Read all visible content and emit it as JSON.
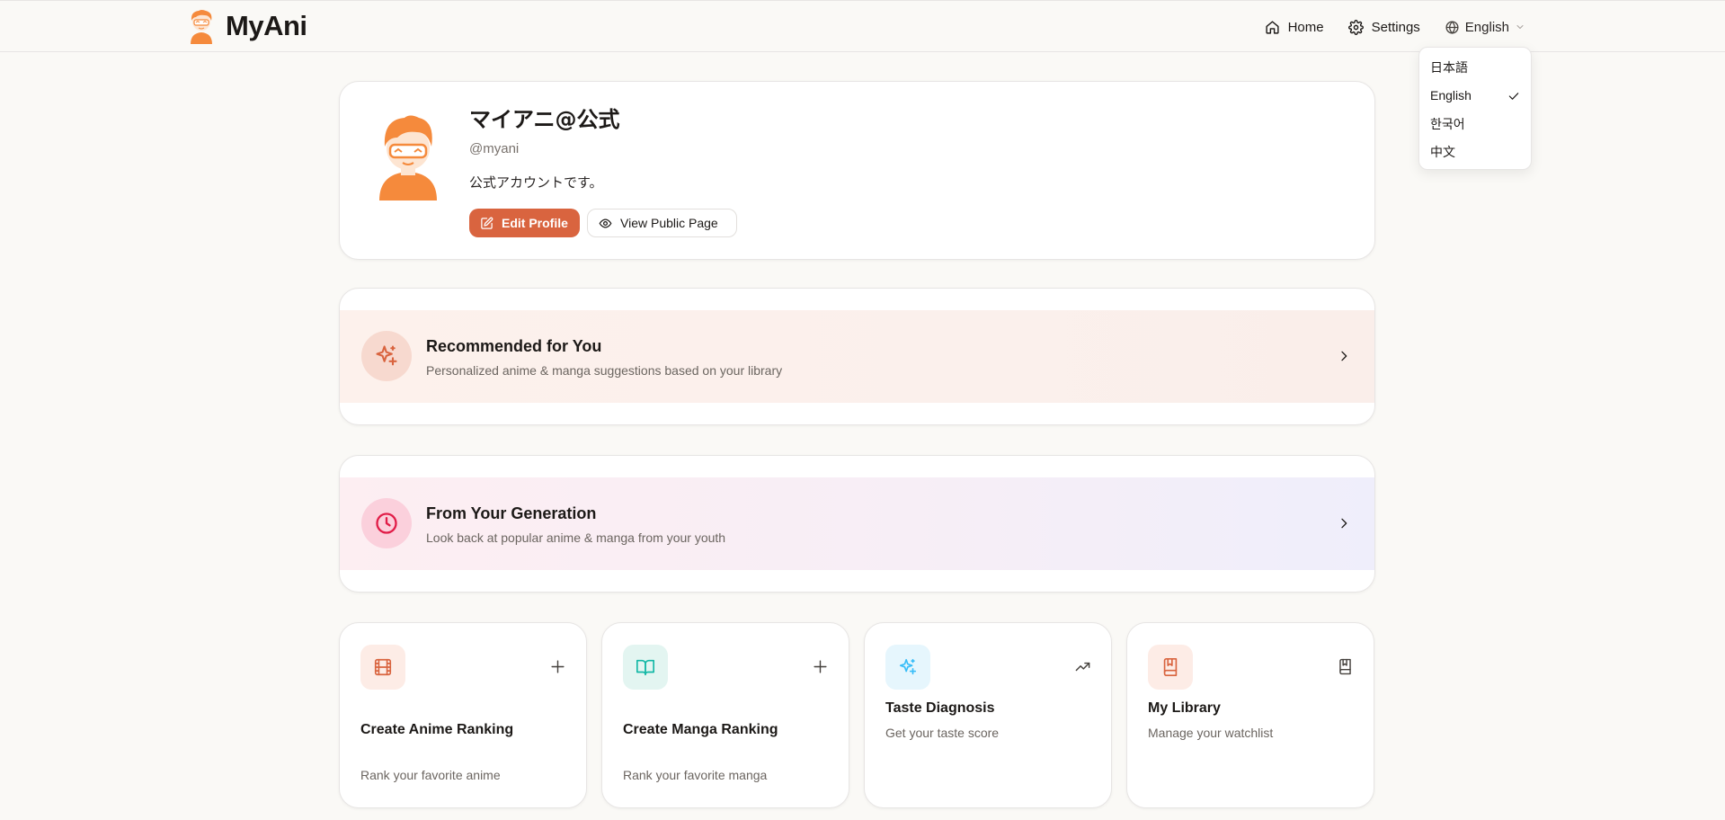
{
  "header": {
    "brand": "MyAni",
    "nav": {
      "home": "Home",
      "settings": "Settings",
      "language": "English"
    }
  },
  "language_menu": {
    "options": [
      "日本語",
      "English",
      "한국어",
      "中文"
    ],
    "selected": "English"
  },
  "profile": {
    "name": "マイアニ@公式",
    "handle": "@myani",
    "bio": "公式アカウントです。",
    "edit_button": "Edit Profile",
    "view_button": "View Public Page"
  },
  "features": {
    "recommended": {
      "title": "Recommended for You",
      "description": "Personalized anime & manga suggestions based on your library"
    },
    "generation": {
      "title": "From Your Generation",
      "description": "Look back at popular anime & manga from your youth"
    }
  },
  "tiles": [
    {
      "title": "Create Anime Ranking",
      "description": "Rank your favorite anime",
      "icon": "film-icon",
      "action_icon": "plus-icon"
    },
    {
      "title": "Create Manga Ranking",
      "description": "Rank your favorite manga",
      "icon": "book-open-icon",
      "action_icon": "plus-icon"
    },
    {
      "title": "Taste Diagnosis",
      "description": "Get your taste score",
      "icon": "sparkles-icon",
      "action_icon": "trending-up-icon"
    },
    {
      "title": "My Library",
      "description": "Manage your watchlist",
      "icon": "bookmark-book-icon",
      "action_icon": "bookmark-book-icon"
    }
  ],
  "colors": {
    "accent": "#d9643f",
    "brand_orange": "#f58a3c",
    "background": "#faf9f6",
    "generation_icon": "#e11d48",
    "manga_icon": "#14b8a6",
    "taste_icon": "#38bdf8"
  }
}
